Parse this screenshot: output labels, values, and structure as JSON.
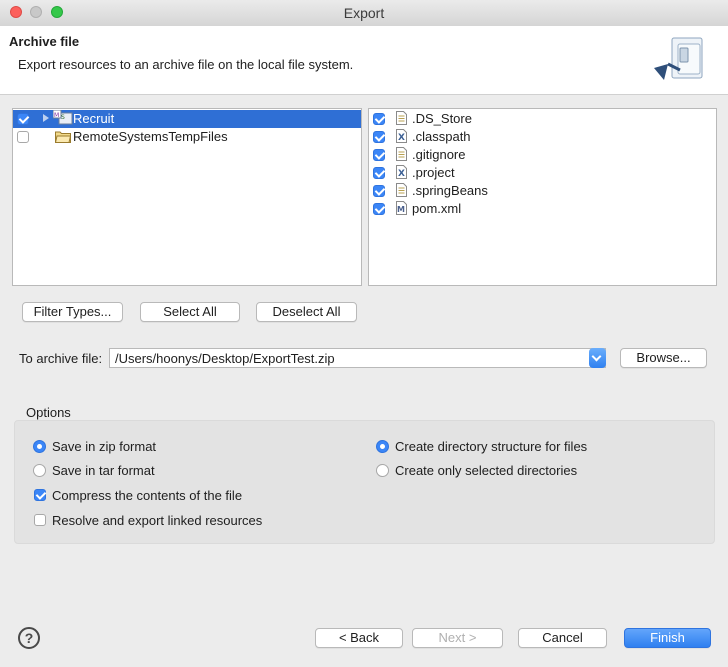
{
  "window": {
    "title": "Export"
  },
  "header": {
    "title": "Archive file",
    "description": "Export resources to an archive file on the local file system."
  },
  "tree": {
    "items": [
      {
        "label": "Recruit",
        "checked": true,
        "selected": true,
        "icon": "project-icon"
      },
      {
        "label": "RemoteSystemsTempFiles",
        "checked": false,
        "selected": false,
        "icon": "folder-icon"
      }
    ]
  },
  "files": {
    "items": [
      {
        "label": ".DS_Store",
        "checked": true,
        "icon": "text-file-icon"
      },
      {
        "label": ".classpath",
        "checked": true,
        "icon": "xml-file-icon"
      },
      {
        "label": ".gitignore",
        "checked": true,
        "icon": "text-file-icon"
      },
      {
        "label": ".project",
        "checked": true,
        "icon": "xml-file-icon"
      },
      {
        "label": ".springBeans",
        "checked": true,
        "icon": "text-file-icon"
      },
      {
        "label": "pom.xml",
        "checked": true,
        "icon": "maven-file-icon"
      }
    ]
  },
  "selection_buttons": {
    "filter_types": "Filter Types...",
    "select_all": "Select All",
    "deselect_all": "Deselect All"
  },
  "archive": {
    "label": "To archive file:",
    "value": "/Users/hoonys/Desktop/ExportTest.zip",
    "browse": "Browse..."
  },
  "options": {
    "title": "Options",
    "save_zip": "Save in zip format",
    "save_tar": "Save in tar format",
    "compress": "Compress the contents of the file",
    "resolve_linked": "Resolve and export linked resources",
    "create_structure": "Create directory structure for files",
    "create_selected": "Create only selected directories",
    "state": {
      "format": "zip",
      "compress": true,
      "resolve_linked": false,
      "structure": "full"
    }
  },
  "footer": {
    "help": "?",
    "back": "< Back",
    "next": "Next >",
    "cancel": "Cancel",
    "finish": "Finish"
  },
  "colors": {
    "selection": "#2f6fd5",
    "accent": "#3b86f7"
  }
}
